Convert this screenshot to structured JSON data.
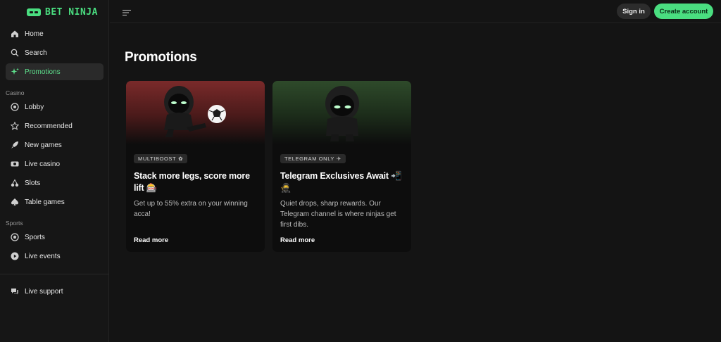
{
  "brand": {
    "name": "BET NINJA",
    "accent": "#4ade80"
  },
  "sidebar": {
    "items_main": [
      {
        "label": "Home",
        "icon": "home-icon"
      },
      {
        "label": "Search",
        "icon": "search-icon"
      },
      {
        "label": "Promotions",
        "icon": "sparkle-icon",
        "active": true
      }
    ],
    "casino_label": "Casino",
    "items_casino": [
      {
        "label": "Lobby",
        "icon": "chip-icon"
      },
      {
        "label": "Recommended",
        "icon": "star-icon"
      },
      {
        "label": "New games",
        "icon": "rocket-icon"
      },
      {
        "label": "Live casino",
        "icon": "camera-icon"
      },
      {
        "label": "Slots",
        "icon": "cherries-icon"
      },
      {
        "label": "Table games",
        "icon": "spade-icon"
      }
    ],
    "sports_label": "Sports",
    "items_sports": [
      {
        "label": "Sports",
        "icon": "ball-icon"
      },
      {
        "label": "Live events",
        "icon": "play-icon"
      }
    ],
    "support": {
      "label": "Live support",
      "icon": "chat-icon"
    }
  },
  "header": {
    "signin_label": "Sign in",
    "create_label": "Create account"
  },
  "main": {
    "title": "Promotions",
    "cards": [
      {
        "badge": "MULTIBOOST",
        "badge_glyph": "✿",
        "title": "Stack more legs, score more lift 🎰",
        "description": "Get up to 55% extra on your winning acca!",
        "link": "Read more"
      },
      {
        "badge": "TELEGRAM ONLY",
        "badge_glyph": "✈",
        "title": "Telegram Exclusives Await 📲🥷",
        "description": "Quiet drops, sharp rewards. Our Telegram channel is where ninjas get first dibs.",
        "link": "Read more"
      }
    ]
  }
}
